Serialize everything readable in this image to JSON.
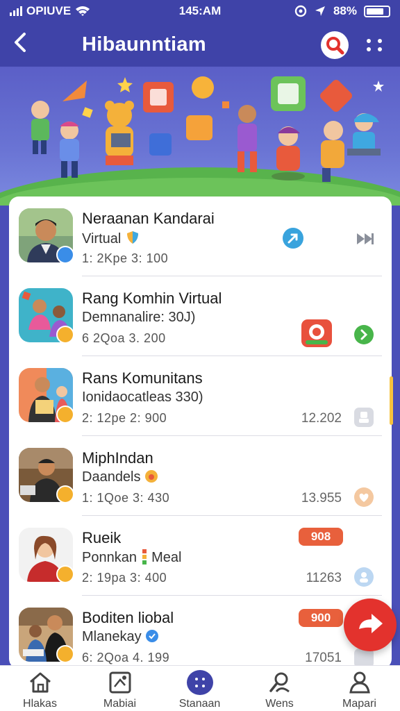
{
  "status": {
    "network": "OPIUVE",
    "time": "145:AM",
    "battery": "88%"
  },
  "header": {
    "title": "Hibaunntiam"
  },
  "list": [
    {
      "name": "Neraanan Kandarai",
      "subtitle": "Virtual",
      "meta": "1: 2Kpe 3: 100",
      "count": ""
    },
    {
      "name": "Rang Komhin Virtual",
      "subtitle": "Demnanalire: 30J)",
      "meta": "6  2Qoa 3. 200",
      "count": ""
    },
    {
      "name": "Rans Komunitans",
      "subtitle": "Ionidaocatleas 330)",
      "meta": "2: 12pe 2: 900",
      "count": "12.202"
    },
    {
      "name": "MiphIndan",
      "subtitle": "Daandels",
      "meta": "1: 1Qoe 3: 430",
      "count": "13.955"
    },
    {
      "name": "Rueik",
      "subtitle": "Ponnkan",
      "subtitle2": "Meal",
      "meta": "2: 19pa 3: 400",
      "count": "11263",
      "pill": "908"
    },
    {
      "name": "Boditen liobal",
      "subtitle": "Mlanekay",
      "meta": "6: 2Qoa 4. 199",
      "count": "17051",
      "pill": "900"
    }
  ],
  "nav": [
    {
      "label": "Hlakas",
      "icon": "home-icon"
    },
    {
      "label": "Mabiai",
      "icon": "photo-icon"
    },
    {
      "label": "Stanaan",
      "icon": "apps-icon"
    },
    {
      "label": "Wens",
      "icon": "search-person-icon"
    },
    {
      "label": "Mapari",
      "icon": "profile-icon"
    }
  ],
  "colors": {
    "primary": "#3f43a8",
    "accent": "#e3322d",
    "pill": "#e8603c"
  }
}
